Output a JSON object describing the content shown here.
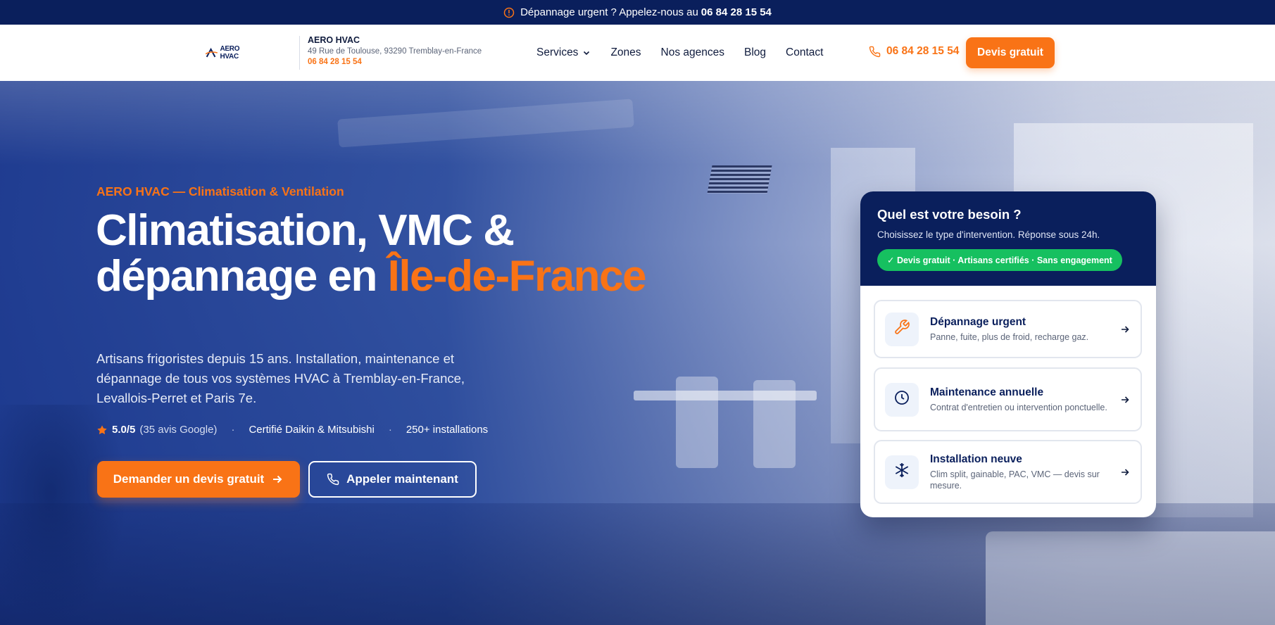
{
  "topbar": {
    "text": "Dépannage urgent ? Appelez-nous au",
    "phone": "06 84 28 15 54",
    "icon": "alert-circle-icon"
  },
  "header": {
    "logo_text": "AERO HVAC",
    "brand_name": "AERO HVAC",
    "address": "49 Rue de Toulouse, 93290 Tremblay-en-France",
    "phone_small": "06 84 28 15 54",
    "nav": [
      {
        "label": "Services"
      },
      {
        "label": "Zones"
      },
      {
        "label": "Nos agences"
      },
      {
        "label": "Blog"
      },
      {
        "label": "Contact"
      }
    ],
    "phone": "06 84 28 15 54",
    "cta": "Devis gratuit"
  },
  "hero": {
    "eyebrow": "AERO HVAC — Climatisation & Ventilation",
    "title_line1": "Climatisation, VMC &",
    "title_line2_prefix": "dépannage en ",
    "title_line2_accent": "Île-de-France",
    "subtitle": "Artisans frigoristes depuis 15 ans. Installation, maintenance et dépannage de tous vos systèmes HVAC à Tremblay-en-France, Levallois-Perret et Paris 7e.",
    "rating": "5.0/5",
    "reviews": "(35 avis Google)",
    "certified": "Certifié Daikin & Mitsubishi",
    "installs": "250+ installations",
    "btn_primary": "Demander un devis gratuit",
    "btn_secondary": "Appeler maintenant"
  },
  "card": {
    "title": "Quel est votre besoin ?",
    "desc": "Choisissez le type d'intervention. Réponse sous 24h.",
    "badge": "✓ Devis gratuit · Artisans certifiés · Sans engagement",
    "options": [
      {
        "title": "Dépannage urgent",
        "desc": "Panne, fuite, plus de froid, recharge gaz.",
        "icon": "wrench-icon"
      },
      {
        "title": "Maintenance annuelle",
        "desc": "Contrat d'entretien ou intervention ponctuelle.",
        "icon": "clock-icon"
      },
      {
        "title": "Installation neuve",
        "desc": "Clim split, gainable, PAC, VMC — devis sur mesure.",
        "icon": "snowflake-icon"
      }
    ]
  },
  "colors": {
    "navy": "#0a1f5c",
    "accent": "#f97316",
    "badge_green": "#16c060"
  }
}
